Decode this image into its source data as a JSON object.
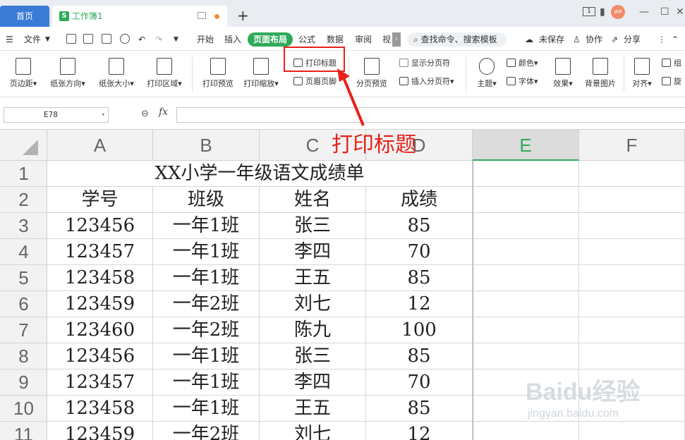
{
  "titlebar": {
    "home_tab": "首页",
    "doc_tab": "工作簿1",
    "badge": "1",
    "avatar": "WP"
  },
  "menu": {
    "file": "文件",
    "items": [
      "开始",
      "插入",
      "页面布局",
      "公式",
      "数据",
      "审阅",
      "视"
    ],
    "active": "页面布局",
    "search": "查找命令、搜索模板",
    "unsaved": "未保存",
    "collab": "协作",
    "share": "分享"
  },
  "ribbon": {
    "margins": "页边距",
    "orientation": "纸张方向",
    "size": "纸张大小",
    "print_area": "打印区域",
    "print_preview": "打印预览",
    "print_scale": "打印缩放",
    "print_title": "打印标题",
    "header_footer": "页眉页脚",
    "page_break_preview": "分页预览",
    "show_page_break": "显示分页符",
    "insert_page_break": "插入分页符",
    "theme": "主题",
    "colors": "颜色",
    "fonts": "字体",
    "effects": "效果",
    "bg_image": "背景图片",
    "align": "对齐",
    "group": "组",
    "rotate": "旋"
  },
  "formula_bar": {
    "cell_ref": "E78",
    "fx_label": "fx",
    "value": ""
  },
  "sheet": {
    "columns": [
      "A",
      "B",
      "C",
      "D",
      "E",
      "F"
    ],
    "selected_column": "E",
    "row_numbers": [
      "1",
      "2",
      "3",
      "4",
      "5",
      "6",
      "7",
      "8",
      "9",
      "10",
      "11"
    ],
    "title": "XX小学一年级语文成绩单",
    "headers": [
      "学号",
      "班级",
      "姓名",
      "成绩"
    ],
    "rows": [
      [
        "123456",
        "一年1班",
        "张三",
        "85"
      ],
      [
        "123457",
        "一年1班",
        "李四",
        "70"
      ],
      [
        "123458",
        "一年1班",
        "王五",
        "85"
      ],
      [
        "123459",
        "一年2班",
        "刘七",
        "12"
      ],
      [
        "123460",
        "一年2班",
        "陈九",
        "100"
      ],
      [
        "123456",
        "一年1班",
        "张三",
        "85"
      ],
      [
        "123457",
        "一年1班",
        "李四",
        "70"
      ],
      [
        "123458",
        "一年1班",
        "王五",
        "85"
      ],
      [
        "123459",
        "一年2班",
        "刘七",
        "12"
      ]
    ]
  },
  "annotation": {
    "label": "打印标题",
    "color": "#e8211b"
  },
  "watermark": {
    "brand": "Baidu经验",
    "url": "jingyan.baidu.com"
  },
  "colors": {
    "accent_green": "#2faa59",
    "home_tab_blue": "#3a7bd5",
    "highlight_red": "#e8211b"
  }
}
